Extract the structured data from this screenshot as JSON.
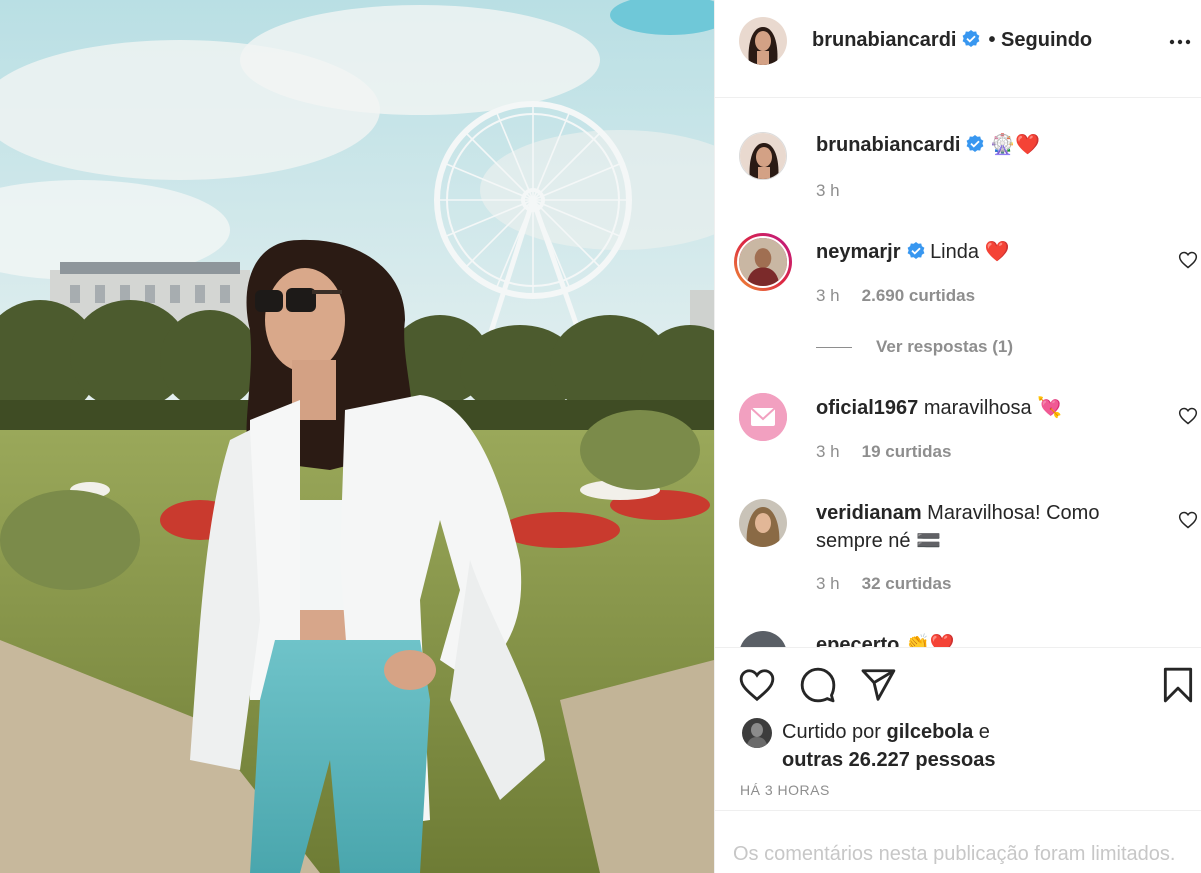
{
  "post": {
    "author": "brunabiancardi",
    "follow_state": "• Seguindo",
    "icons": {
      "verified": "verified-badge-icon",
      "more": "more-options-icon"
    }
  },
  "caption": {
    "username": "brunabiancardi",
    "text": "🎡❤️",
    "time": "3 h"
  },
  "comments": [
    {
      "username": "neymarjr",
      "text": "Linda ❤️",
      "time": "3 h",
      "likes": "2.690 curtidas",
      "view_replies": "Ver respostas (1)"
    },
    {
      "username": "oficial1967",
      "text": "maravilhosa 💘",
      "time": "3 h",
      "likes": "19 curtidas"
    },
    {
      "username": "veridianam",
      "text": "Maravilhosa! Como sempre né 🟰",
      "time": "3 h",
      "likes": "32 curtidas"
    },
    {
      "username": "epecerto",
      "text": "👏❤️"
    }
  ],
  "actions": {
    "like": "heart-icon",
    "comment": "comment-bubble-icon",
    "share": "paper-plane-icon",
    "save": "bookmark-icon"
  },
  "likes": {
    "prefix": "Curtido por",
    "by": "gilcebola",
    "joiner": "e",
    "others": "outras 26.227 pessoas"
  },
  "time_ago": "HÁ 3 HORAS",
  "comments_limited": "Os comentários nesta publicação foram limitados.",
  "colors": {
    "verified": "#3897f0",
    "muted": "#8e8e8e",
    "text": "#262626",
    "border": "#efefef"
  }
}
